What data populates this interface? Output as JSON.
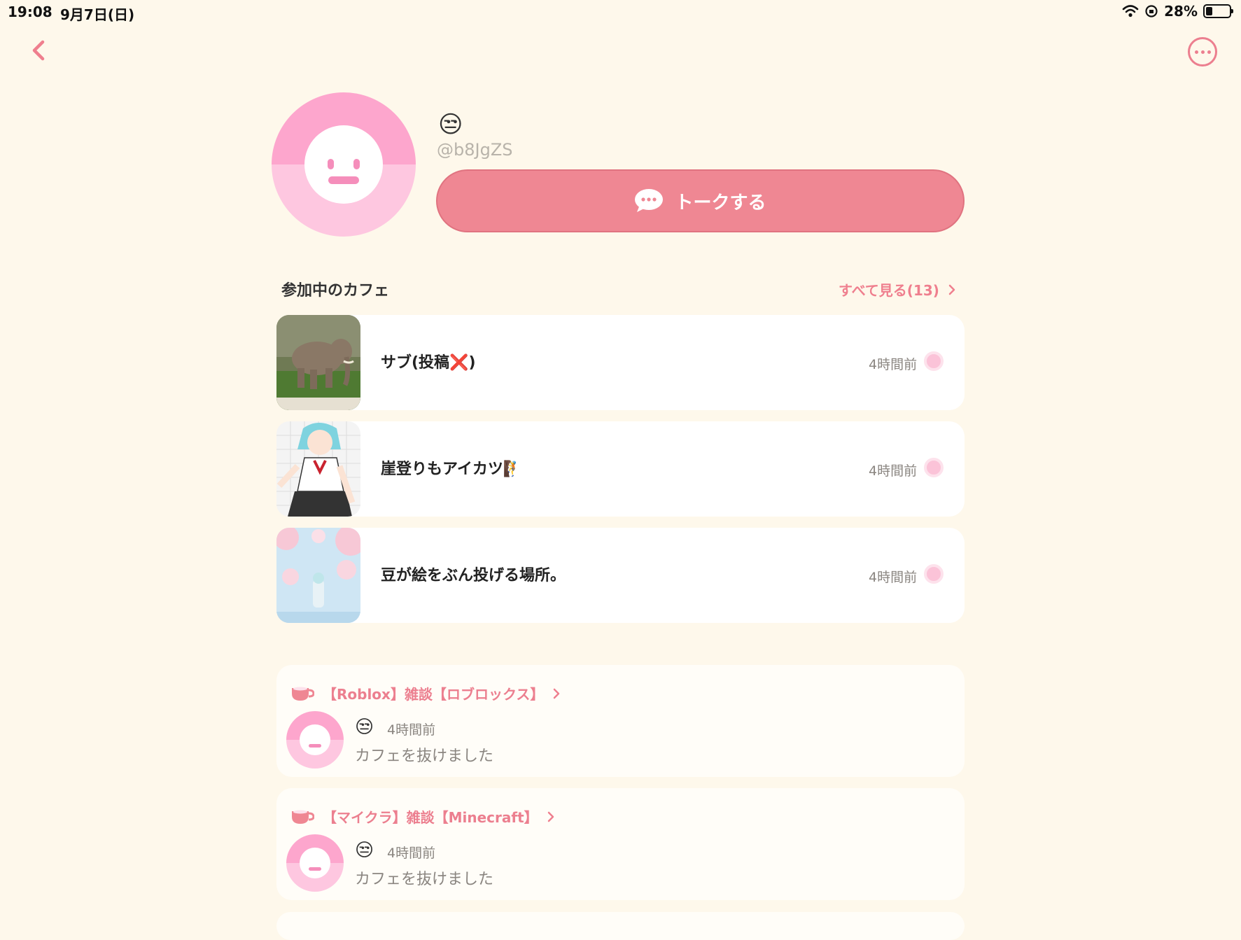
{
  "status_bar": {
    "time": "19:08",
    "date": "9月7日(日)",
    "battery": "28%",
    "battery_level": 0.28
  },
  "nav": {
    "back_icon": "chevron-left-icon",
    "more_icon": "more-horizontal-icon"
  },
  "profile": {
    "emoji": "😒",
    "handle": "@b8JgZS",
    "talk_label": "トークする"
  },
  "cafes_section": {
    "title": "参加中のカフェ",
    "see_all": "すべて見る(13)"
  },
  "cafes": [
    {
      "name": "サブ(投稿❌)",
      "time": "4時間前"
    },
    {
      "name": "崖登りもアイカツ🧗",
      "time": "4時間前"
    },
    {
      "name": "豆が絵をぶん投げる場所。",
      "time": "4時間前"
    }
  ],
  "activities": [
    {
      "cafe": "【Roblox】雑談【ロブロックス】",
      "emoji": "😒",
      "time": "4時間前",
      "text": "カフェを抜けました"
    },
    {
      "cafe": "【マイクラ】雑談【Minecraft】",
      "emoji": "😒",
      "time": "4時間前",
      "text": "カフェを抜けました"
    }
  ],
  "colors": {
    "background": "#fef8eb",
    "accent": "#ef8793",
    "avatar_pink": "#fda6cd"
  }
}
